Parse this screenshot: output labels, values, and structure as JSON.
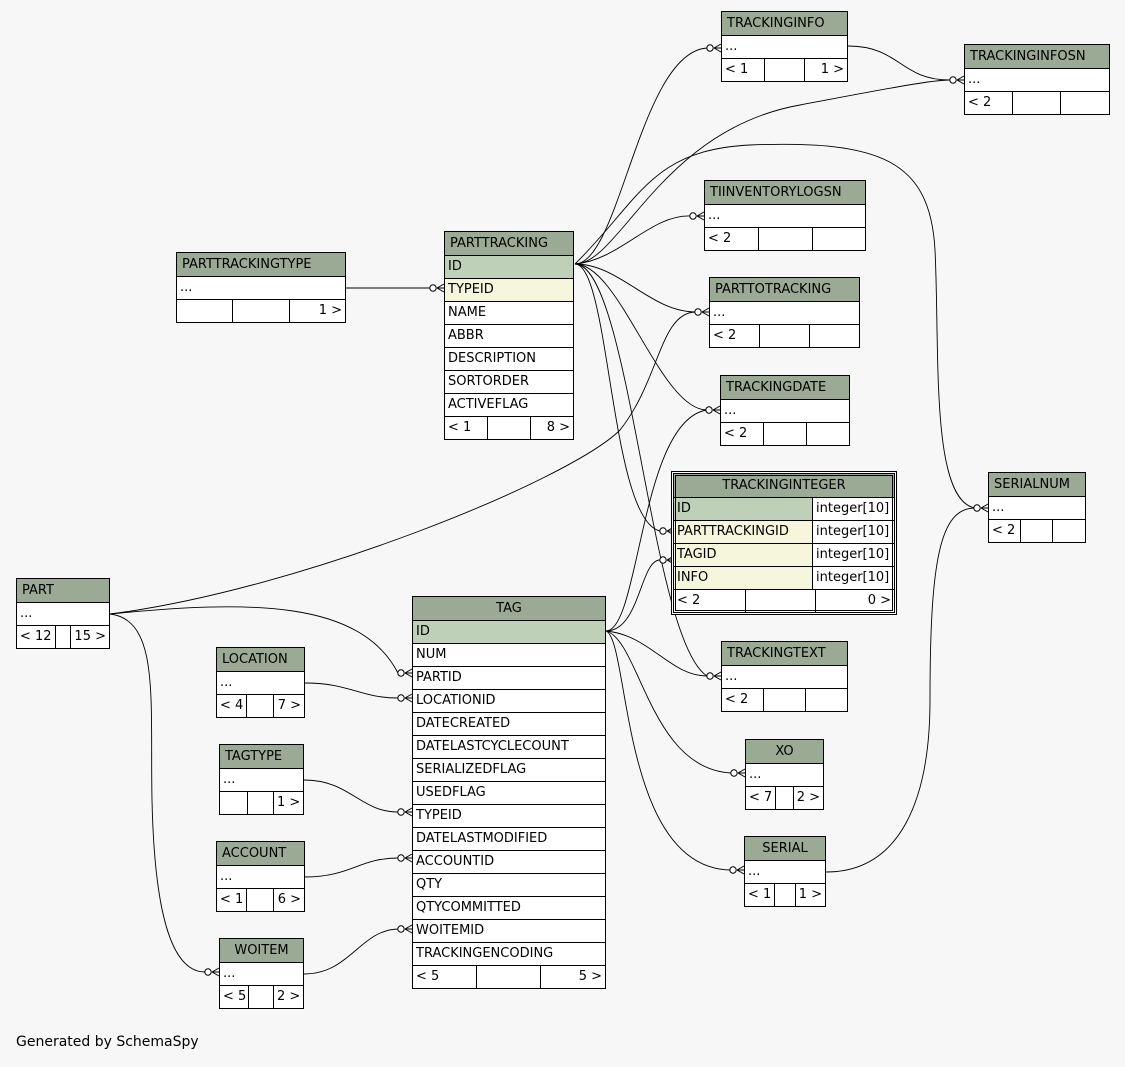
{
  "tables": {
    "trackinginfo": {
      "name": "TRACKINGINFO",
      "rows": [
        "..."
      ],
      "counts": [
        "< 1",
        "",
        "1 >"
      ]
    },
    "trackinginfosn": {
      "name": "TRACKINGINFOSN",
      "rows": [
        "..."
      ],
      "counts": [
        "< 2",
        "",
        ""
      ]
    },
    "tiinventorylogsn": {
      "name": "TIINVENTORYLOGSN",
      "rows": [
        "..."
      ],
      "counts": [
        "< 2",
        "",
        ""
      ]
    },
    "parttotracking": {
      "name": "PARTTOTRACKING",
      "rows": [
        "..."
      ],
      "counts": [
        "< 2",
        "",
        ""
      ]
    },
    "trackingdate": {
      "name": "TRACKINGDATE",
      "rows": [
        "..."
      ],
      "counts": [
        "< 2",
        "",
        ""
      ]
    },
    "parttrackingtype": {
      "name": "PARTTRACKINGTYPE",
      "rows": [
        "..."
      ],
      "counts": [
        "",
        "",
        "1 >"
      ]
    },
    "parttracking": {
      "name": "PARTTRACKING",
      "rows": [
        "ID",
        "TYPEID",
        "NAME",
        "ABBR",
        "DESCRIPTION",
        "SORTORDER",
        "ACTIVEFLAG"
      ],
      "counts": [
        "< 1",
        "",
        "8 >"
      ]
    },
    "trackinginteger": {
      "name": "TRACKINGINTEGER",
      "rows": [
        {
          "name": "ID",
          "type": "integer[10]"
        },
        {
          "name": "PARTTRACKINGID",
          "type": "integer[10]"
        },
        {
          "name": "TAGID",
          "type": "integer[10]"
        },
        {
          "name": "INFO",
          "type": "integer[10]"
        }
      ],
      "counts": [
        "< 2",
        "",
        "0 >"
      ]
    },
    "serialnum": {
      "name": "SERIALNUM",
      "rows": [
        "..."
      ],
      "counts": [
        "< 2",
        "",
        ""
      ]
    },
    "part": {
      "name": "PART",
      "rows": [
        "..."
      ],
      "counts": [
        "< 12",
        "",
        "15 >"
      ]
    },
    "tag": {
      "name": "TAG",
      "rows": [
        "ID",
        "NUM",
        "PARTID",
        "LOCATIONID",
        "DATECREATED",
        "DATELASTCYCLECOUNT",
        "SERIALIZEDFLAG",
        "USEDFLAG",
        "TYPEID",
        "DATELASTMODIFIED",
        "ACCOUNTID",
        "QTY",
        "QTYCOMMITTED",
        "WOITEMID",
        "TRACKINGENCODING"
      ],
      "counts": [
        "< 5",
        "",
        "5 >"
      ]
    },
    "location": {
      "name": "LOCATION",
      "rows": [
        "..."
      ],
      "counts": [
        "< 4",
        "",
        "7 >"
      ]
    },
    "trackingtext": {
      "name": "TRACKINGTEXT",
      "rows": [
        "..."
      ],
      "counts": [
        "< 2",
        "",
        ""
      ]
    },
    "tagtype": {
      "name": "TAGTYPE",
      "rows": [
        "..."
      ],
      "counts": [
        "",
        "",
        "1 >"
      ]
    },
    "xo": {
      "name": "XO",
      "rows": [
        "..."
      ],
      "counts": [
        "< 7",
        "",
        "2 >"
      ]
    },
    "account": {
      "name": "ACCOUNT",
      "rows": [
        "..."
      ],
      "counts": [
        "< 1",
        "",
        "6 >"
      ]
    },
    "serial": {
      "name": "SERIAL",
      "rows": [
        "..."
      ],
      "counts": [
        "< 1",
        "",
        "1 >"
      ]
    },
    "woitem": {
      "name": "WOITEM",
      "rows": [
        "..."
      ],
      "counts": [
        "< 5",
        "",
        "2 >"
      ]
    }
  },
  "footer": "Generated by SchemaSpy"
}
